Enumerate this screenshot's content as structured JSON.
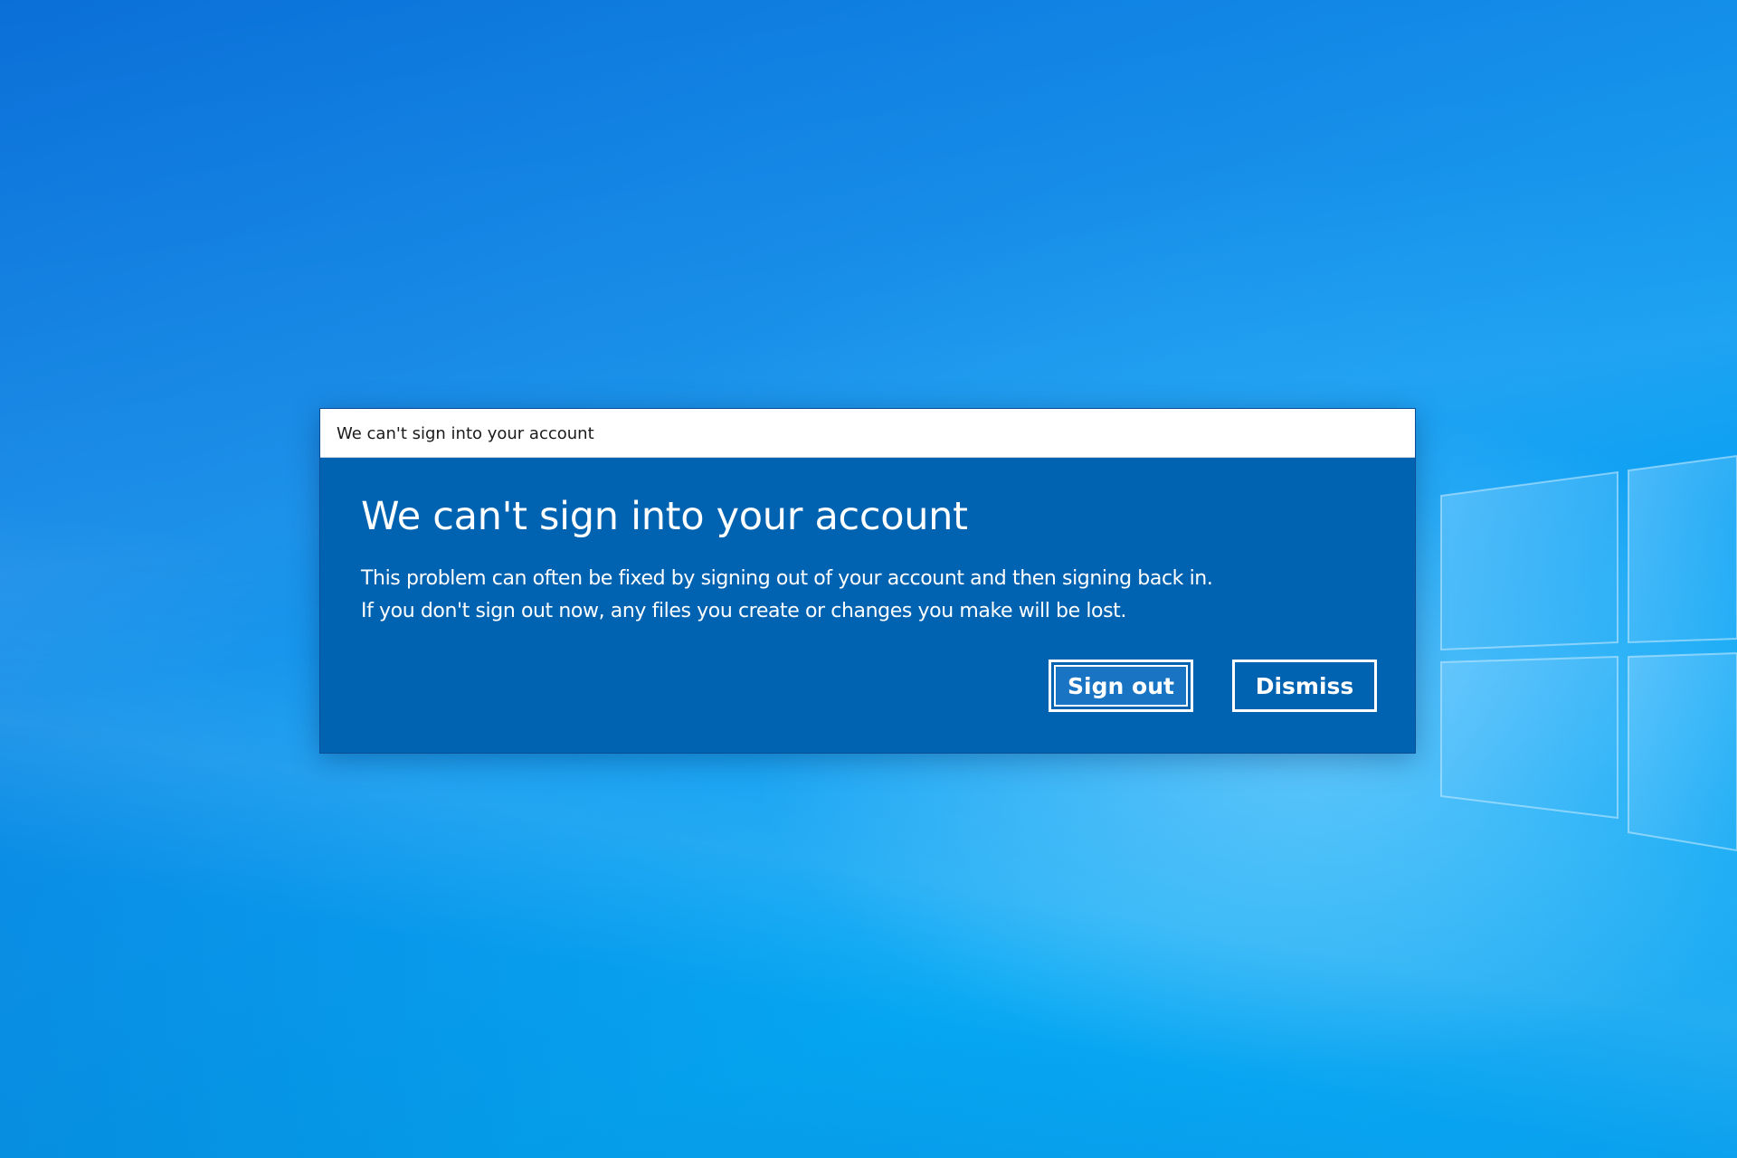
{
  "dialog": {
    "title_bar": "We can't sign into your account",
    "headline": "We can't sign into your account",
    "message_line1": "This problem can often be fixed by signing out of your account and then signing back in.",
    "message_line2": "If you don't sign out now, any files you create or changes you make will be lost.",
    "buttons": {
      "sign_out": "Sign out",
      "dismiss": "Dismiss"
    }
  },
  "desktop": {
    "logo_icon": "windows-logo-icon"
  },
  "colors": {
    "dialog_accent": "#0063b1",
    "titlebar_bg": "#ffffff",
    "desktop_blue": "#0a9bf0"
  }
}
